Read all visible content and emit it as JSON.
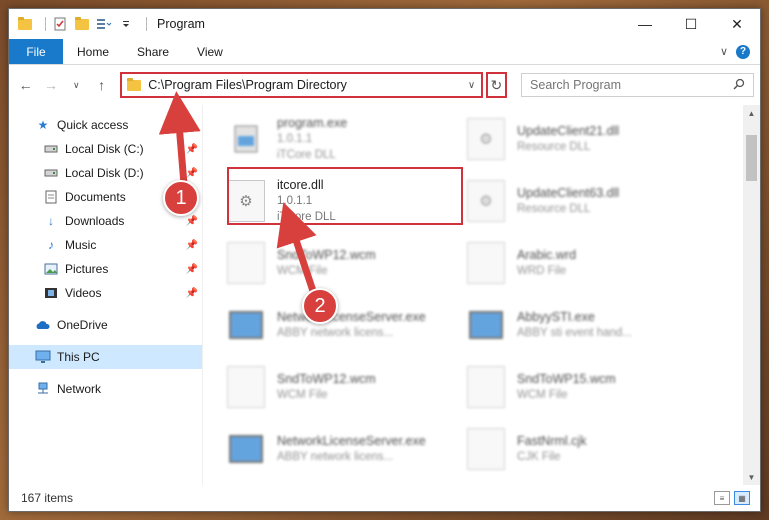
{
  "window": {
    "title": "Program",
    "minimize_glyph": "—",
    "maximize_glyph": "☐",
    "close_glyph": "✕"
  },
  "ribbon": {
    "tabs": [
      "File",
      "Home",
      "Share",
      "View"
    ],
    "expand_glyph": "∨",
    "help_glyph": "?"
  },
  "address": {
    "path": "C:\\Program Files\\Program Directory",
    "dropdown_glyph": "∨",
    "refresh_glyph": "↻"
  },
  "search": {
    "placeholder": "Search Program",
    "icon": "search-icon"
  },
  "nav": {
    "items": [
      {
        "label": "Quick access",
        "icon": "star-icon",
        "pinned": false
      },
      {
        "label": "Local Disk (C:)",
        "icon": "drive-icon",
        "pinned": true
      },
      {
        "label": "Local Disk (D:)",
        "icon": "drive-icon",
        "pinned": true
      },
      {
        "label": "Documents",
        "icon": "documents-icon",
        "pinned": true
      },
      {
        "label": "Downloads",
        "icon": "download-icon",
        "pinned": true
      },
      {
        "label": "Music",
        "icon": "music-icon",
        "pinned": true
      },
      {
        "label": "Pictures",
        "icon": "pictures-icon",
        "pinned": true
      },
      {
        "label": "Videos",
        "icon": "videos-icon",
        "pinned": true
      },
      {
        "label": "OneDrive",
        "icon": "cloud-icon",
        "pinned": false
      },
      {
        "label": "This PC",
        "icon": "monitor-icon",
        "pinned": false,
        "selected": true
      },
      {
        "label": "Network",
        "icon": "network-icon",
        "pinned": false
      }
    ]
  },
  "files": [
    {
      "name": "program.exe",
      "meta1": "1.0.1.1",
      "meta2": "iTCore DLL",
      "blurred": true
    },
    {
      "name": "UpdateClient21.dll",
      "meta1": "Resource DLL",
      "meta2": "",
      "blurred": true
    },
    {
      "name": "itcore.dll",
      "meta1": "1.0.1.1",
      "meta2": "iTCore DLL",
      "blurred": false
    },
    {
      "name": "UpdateClient63.dll",
      "meta1": "Resource DLL",
      "meta2": "",
      "blurred": true
    },
    {
      "name": "SndToWP12.wcm",
      "meta1": "WCM File",
      "meta2": "",
      "blurred": true
    },
    {
      "name": "Arabic.wrd",
      "meta1": "WRD File",
      "meta2": "",
      "blurred": true
    },
    {
      "name": "NetworkLicenseServer.exe",
      "meta1": "ABBY network licens...",
      "meta2": "",
      "blurred": true
    },
    {
      "name": "AbbyySTI.exe",
      "meta1": "ABBY sti event hand...",
      "meta2": "",
      "blurred": true
    },
    {
      "name": "SndToWP12.wcm",
      "meta1": "WCM File",
      "meta2": "",
      "blurred": true
    },
    {
      "name": "SndToWP15.wcm",
      "meta1": "WCM File",
      "meta2": "",
      "blurred": true
    },
    {
      "name": "NetworkLicenseServer.exe",
      "meta1": "ABBY network licens...",
      "meta2": "",
      "blurred": true
    },
    {
      "name": "FastNrml.cjk",
      "meta1": "CJK File",
      "meta2": "",
      "blurred": true
    }
  ],
  "status": {
    "count": "167 items"
  },
  "annotations": {
    "badge1": "1",
    "badge2": "2",
    "color": "#d8403e"
  }
}
